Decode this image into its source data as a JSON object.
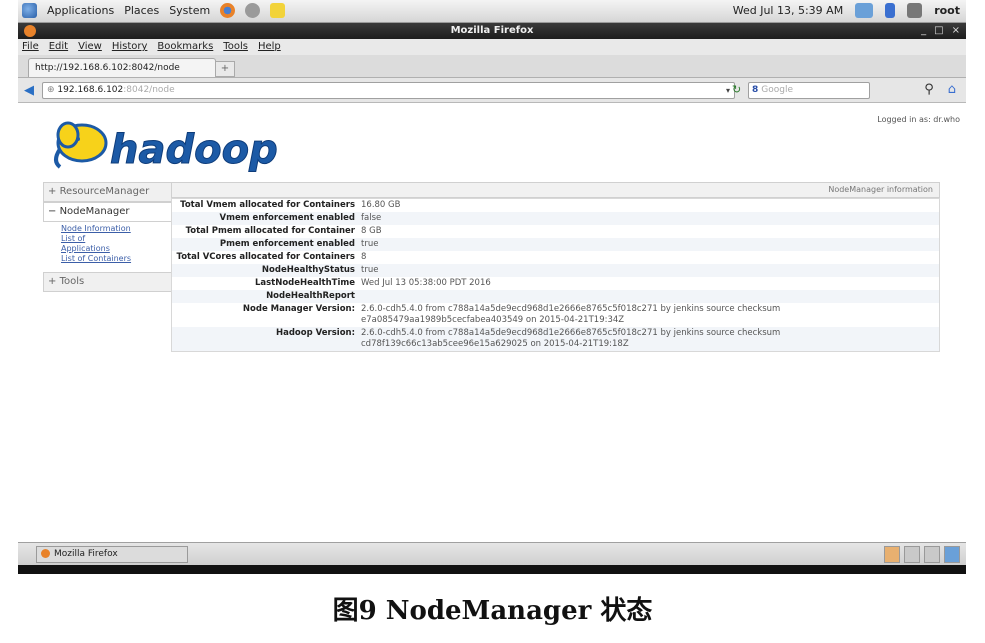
{
  "gnome_panel": {
    "menus": [
      "Applications",
      "Places",
      "System"
    ],
    "datetime": "Wed Jul 13,  5:39 AM",
    "user": "root"
  },
  "window": {
    "title": "Mozilla Firefox"
  },
  "menubar": [
    "File",
    "Edit",
    "View",
    "History",
    "Bookmarks",
    "Tools",
    "Help"
  ],
  "tab": {
    "label": "http://192.168.6.102:8042/node"
  },
  "navbar": {
    "url_host": "192.168.6.102",
    "url_path": ":8042/node",
    "search_engine": "8",
    "search_placeholder": "Google"
  },
  "header": {
    "logo_text": "hadoop",
    "logged_in": "Logged in as: dr.who"
  },
  "sidebar": {
    "sections": [
      {
        "label": "ResourceManager",
        "open": false
      },
      {
        "label": "NodeManager",
        "open": true
      },
      {
        "label": "Tools",
        "open": false
      }
    ],
    "node_links": [
      "Node Information",
      "List of",
      "Applications",
      "List of Containers"
    ]
  },
  "panel": {
    "title": "NodeManager information",
    "rows": [
      {
        "key": "Total Vmem allocated for Containers",
        "value": "16.80 GB"
      },
      {
        "key": "Vmem enforcement enabled",
        "value": "false"
      },
      {
        "key": "Total Pmem allocated for Container",
        "value": "8 GB"
      },
      {
        "key": "Pmem enforcement enabled",
        "value": "true"
      },
      {
        "key": "Total VCores allocated for Containers",
        "value": "8"
      },
      {
        "key": "NodeHealthyStatus",
        "value": "true"
      },
      {
        "key": "LastNodeHealthTime",
        "value": "Wed Jul 13 05:38:00 PDT 2016"
      },
      {
        "key": "NodeHealthReport",
        "value": ""
      },
      {
        "key": "Node Manager Version:",
        "value": "2.6.0-cdh5.4.0 from c788a14a5de9ecd968d1e2666e8765c5f018c271 by jenkins source checksum e7a085479aa1989b5cecfabea403549 on 2015-04-21T19:34Z"
      },
      {
        "key": "Hadoop Version:",
        "value": "2.6.0-cdh5.4.0 from c788a14a5de9ecd968d1e2666e8765c5f018c271 by jenkins source checksum cd78f139c66c13ab5cee96e15a629025 on 2015-04-21T19:18Z"
      }
    ]
  },
  "taskbar": {
    "task_label": "Mozilla Firefox"
  },
  "caption": "图9   NodeManager 状态",
  "colors": {
    "link": "#3b5ea8",
    "firefox_orange": "#e8822a",
    "logo_yellow": "#f7d21a",
    "logo_blue": "#1c5aa6"
  }
}
